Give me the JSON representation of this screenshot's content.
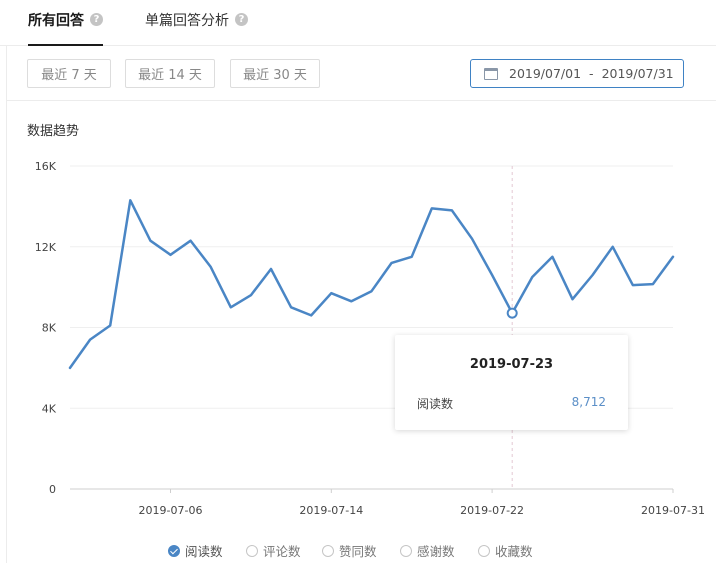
{
  "tabs": {
    "all": "所有回答",
    "single": "单篇回答分析"
  },
  "range_buttons": {
    "d7": "最近 7 天",
    "d14": "最近 14 天",
    "d30": "最近 30 天"
  },
  "date_range": {
    "start": "2019/07/01",
    "separator": "-",
    "end": "2019/07/31"
  },
  "section_title": "数据趋势",
  "tooltip": {
    "date": "2019-07-23",
    "label": "阅读数",
    "value": "8,712"
  },
  "legend": [
    {
      "name": "阅读数",
      "checked": true
    },
    {
      "name": "评论数",
      "checked": false
    },
    {
      "name": "赞同数",
      "checked": false
    },
    {
      "name": "感谢数",
      "checked": false
    },
    {
      "name": "收藏数",
      "checked": false
    }
  ],
  "colors": {
    "series": "#4a86c5",
    "accent": "#3f82c4"
  },
  "chart_data": {
    "type": "line",
    "y_ticks": [
      "0",
      "4K",
      "8K",
      "12K",
      "16K"
    ],
    "ylim": [
      0,
      16000
    ],
    "x_tick_labels": [
      "2019-07-06",
      "2019-07-14",
      "2019-07-22",
      "2019-07-31"
    ],
    "x": [
      "2019-07-01",
      "2019-07-02",
      "2019-07-03",
      "2019-07-04",
      "2019-07-05",
      "2019-07-06",
      "2019-07-07",
      "2019-07-08",
      "2019-07-09",
      "2019-07-10",
      "2019-07-11",
      "2019-07-12",
      "2019-07-13",
      "2019-07-14",
      "2019-07-15",
      "2019-07-16",
      "2019-07-17",
      "2019-07-18",
      "2019-07-19",
      "2019-07-20",
      "2019-07-21",
      "2019-07-22",
      "2019-07-23",
      "2019-07-24",
      "2019-07-25",
      "2019-07-26",
      "2019-07-27",
      "2019-07-28",
      "2019-07-29",
      "2019-07-30",
      "2019-07-31"
    ],
    "series": [
      {
        "name": "阅读数",
        "values": [
          6000,
          7400,
          8100,
          14300,
          12300,
          11600,
          12300,
          11000,
          9000,
          9600,
          10900,
          9000,
          8600,
          9700,
          9300,
          9800,
          11200,
          11500,
          13900,
          13800,
          12400,
          10600,
          8712,
          10500,
          11500,
          9400,
          10600,
          12000,
          10100,
          10150,
          11500
        ]
      }
    ],
    "highlight_index": 22,
    "grid": "horizontal"
  }
}
